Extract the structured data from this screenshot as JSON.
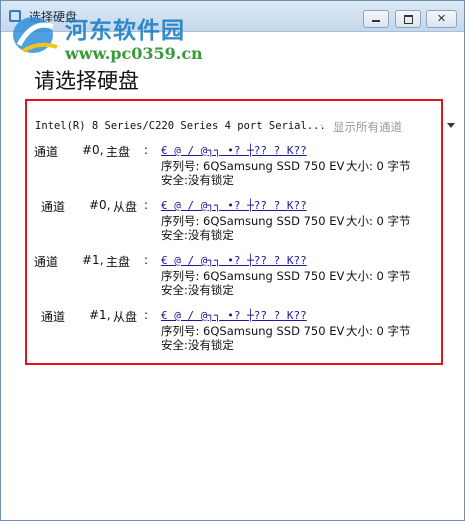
{
  "window": {
    "title": "选择硬盘",
    "watermark_name": "河东软件园",
    "watermark_url": "www.pc0359.cn"
  },
  "heading": "请选择硬盘",
  "controller": {
    "name": "Intel(R) 8 Series/C220 Series 4 port Serial...",
    "separator": "·",
    "show_all_label": "显示所有通道"
  },
  "channels": [
    {
      "label": "通道",
      "port": "#0,",
      "role": "主盘",
      "colon": ":",
      "garbled": "€  @  / @┐┐  •?   ┼?? ?  K??",
      "serial_label": "序列号:",
      "serial": "6QSamsung SSD 750 EV",
      "size_label": "大小:",
      "size": "0 字节",
      "security_label": "安全:",
      "security": "没有锁定"
    },
    {
      "label": "通道",
      "port": "#0,",
      "role": "从盘",
      "colon": ":",
      "garbled": "€  @  / @┐┐  •?   ┼?? ?  K??",
      "serial_label": "序列号:",
      "serial": "6QSamsung SSD 750 EV",
      "size_label": "大小:",
      "size": "0 字节",
      "security_label": "安全:",
      "security": "没有锁定"
    },
    {
      "label": "通道",
      "port": "#1,",
      "role": "主盘",
      "colon": ":",
      "garbled": "€  @  / @┐┐  •?   ┼?? ?  K??",
      "serial_label": "序列号:",
      "serial": "6QSamsung SSD 750 EV",
      "size_label": "大小:",
      "size": "0 字节",
      "security_label": "安全:",
      "security": "没有锁定"
    },
    {
      "label": "通道",
      "port": "#1,",
      "role": "从盘",
      "colon": ":",
      "garbled": "€  @  / @┐┐  •?   ┼?? ?  K??",
      "serial_label": "序列号:",
      "serial": "6QSamsung SSD 750 EV",
      "size_label": "大小:",
      "size": "0 字节",
      "security_label": "安全:",
      "security": "没有锁定"
    }
  ],
  "colors": {
    "highlight_border": "#e0141e",
    "link_text": "#1a1a9a",
    "muted_text": "#9a9a9a"
  }
}
